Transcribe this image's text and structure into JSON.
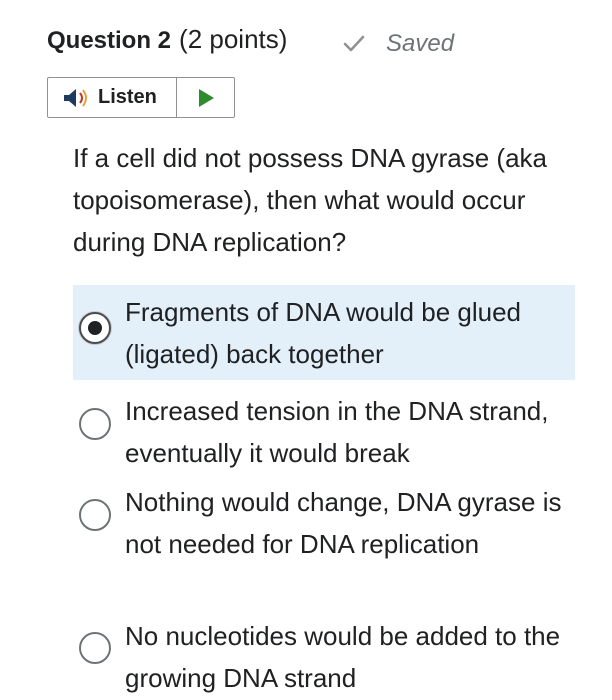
{
  "question": {
    "title": "Question 2",
    "points": "(2 points)",
    "saved_label": "Saved",
    "text": "If a cell did not possess DNA gyrase (aka topoisomerase), then what would occur during DNA replication?"
  },
  "listen": {
    "label": "Listen"
  },
  "options": [
    {
      "text": "Fragments of DNA would be glued (ligated) back together",
      "selected": true
    },
    {
      "text": "Increased tension in the DNA strand, eventually it would break",
      "selected": false
    },
    {
      "text": "Nothing would change, DNA gyrase is not needed for DNA replication",
      "selected": false
    },
    {
      "text": "No nucleotides would be added to the growing DNA strand",
      "selected": false
    }
  ],
  "colors": {
    "selected_bg": "#e3f0fa",
    "play_green": "#2e8b2e",
    "speaker_red": "#c0392b"
  },
  "icons": [
    "check-icon",
    "speaker-icon",
    "play-icon",
    "radio-icon"
  ]
}
